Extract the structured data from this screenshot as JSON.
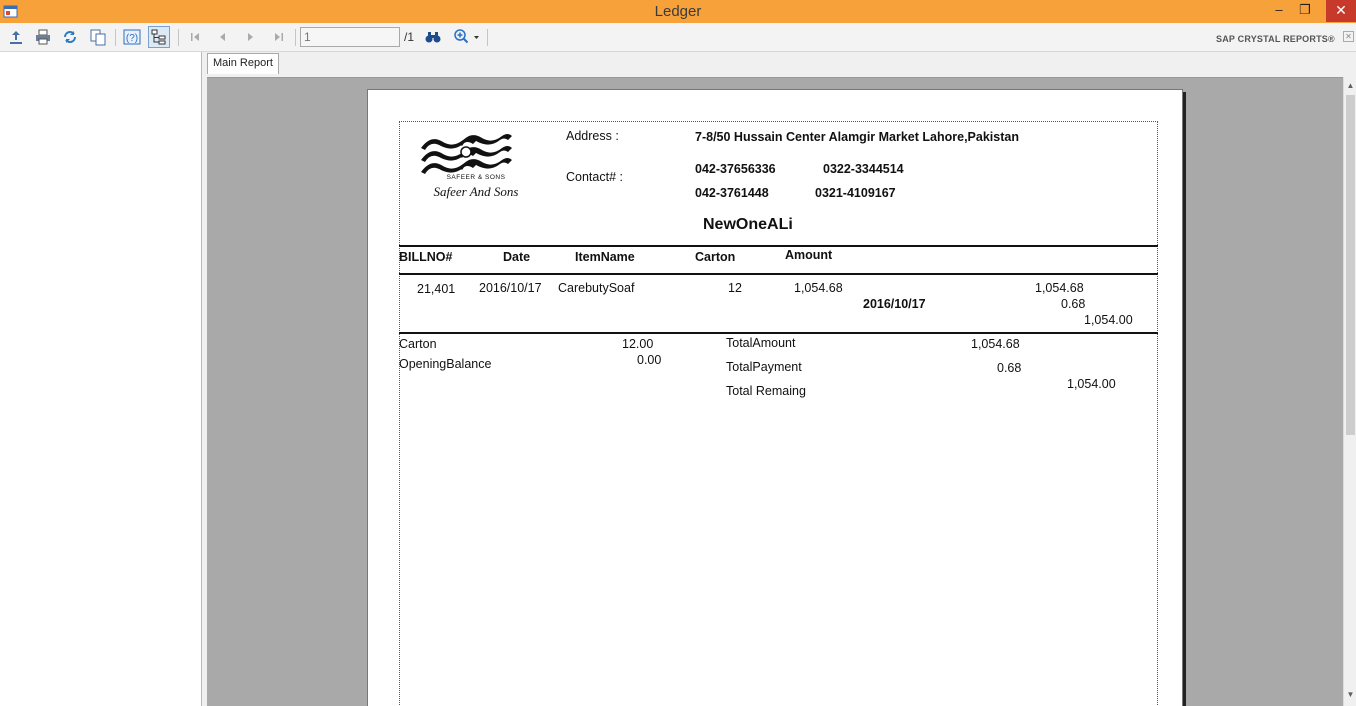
{
  "window": {
    "title": "Ledger",
    "minimize_glyph": "–",
    "maximize_glyph": "❐",
    "close_glyph": "✕"
  },
  "toolbar": {
    "page_value": "1",
    "page_total": "/1",
    "brand": "SAP CRYSTAL REPORTS®",
    "icons": [
      "export-icon",
      "print-icon",
      "refresh-icon",
      "copy-icon",
      "help-icon",
      "group-tree-icon",
      "first-page-icon",
      "previous-page-icon",
      "next-page-icon",
      "last-page-icon",
      "find-icon",
      "zoom-icon"
    ]
  },
  "tabs": {
    "main_report": "Main Report"
  },
  "report": {
    "company": {
      "logo_subtitle": "SAFEER & SONS",
      "logo_script": "Safeer And Sons"
    },
    "address_label": "Address :",
    "address_value": "7-8/50 Hussain Center  Alamgir Market Lahore,Pakistan",
    "contact_label": "Contact# :",
    "contact_1": "042-37656336",
    "contact_2": "0322-3344514",
    "contact_3": "042-3761448",
    "contact_4": "0321-4109167",
    "customer_name": "NewOneALi",
    "columns": {
      "billno": "BILLNO#",
      "date": "Date",
      "itemname": "ItemName",
      "carton": "Carton",
      "amount": "Amount"
    },
    "row": {
      "billno": "21,401",
      "date": "2016/10/17",
      "itemname": "CarebutySoaf",
      "carton": "12",
      "amount": "1,054.68",
      "group_date": "2016/10/17",
      "group_total": "1,054.68",
      "group_payment": "0.68",
      "group_remaining": "1,054.00"
    },
    "summary": {
      "carton_label": "Carton",
      "carton_value": "12.00",
      "opening_label": "OpeningBalance",
      "opening_value": "0.00",
      "total_amount_label": "TotalAmount",
      "total_amount_value": "1,054.68",
      "total_payment_label": "TotalPayment",
      "total_payment_value": "0.68",
      "total_remaining_label": "Total Remaing",
      "total_remaining_value": "1,054.00"
    }
  },
  "colors": {
    "titlebar": "#f7a13a",
    "close_button": "#c7392b",
    "viewer_background": "#a9a9a9"
  }
}
